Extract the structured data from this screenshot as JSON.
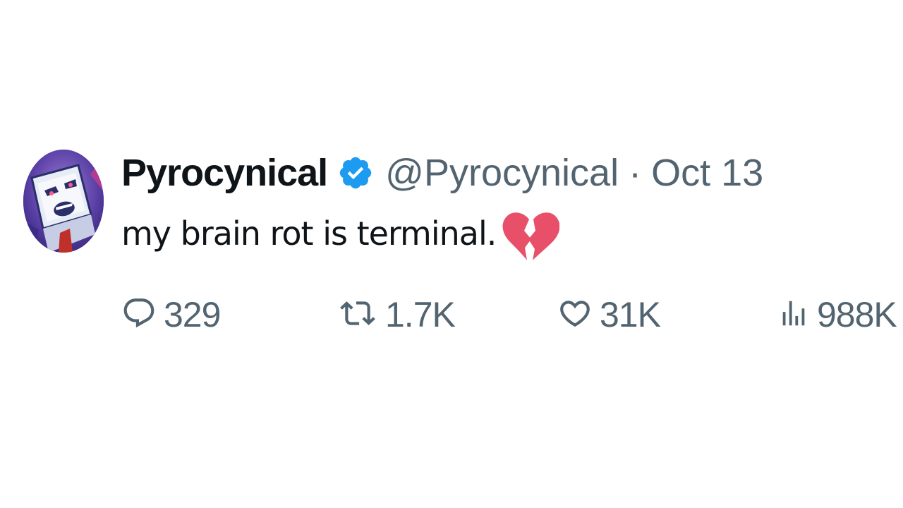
{
  "tweet": {
    "display_name": "Pyrocynical",
    "handle": "@Pyrocynical",
    "separator": "·",
    "date": "Oct 13",
    "text": "my brain rot is terminal.",
    "emoji": "broken-heart",
    "verified": true
  },
  "actions": {
    "reply_count": "329",
    "retweet_count": "1.7K",
    "like_count": "31K",
    "view_count": "988K"
  },
  "icons": {
    "verified": "verified-badge-icon",
    "reply": "reply-icon",
    "retweet": "retweet-icon",
    "like": "heart-icon",
    "views": "views-icon"
  },
  "colors": {
    "text": "#0f1419",
    "secondary": "#536471",
    "verified_blue": "#1d9bf0",
    "broken_heart": "#e8506a"
  }
}
